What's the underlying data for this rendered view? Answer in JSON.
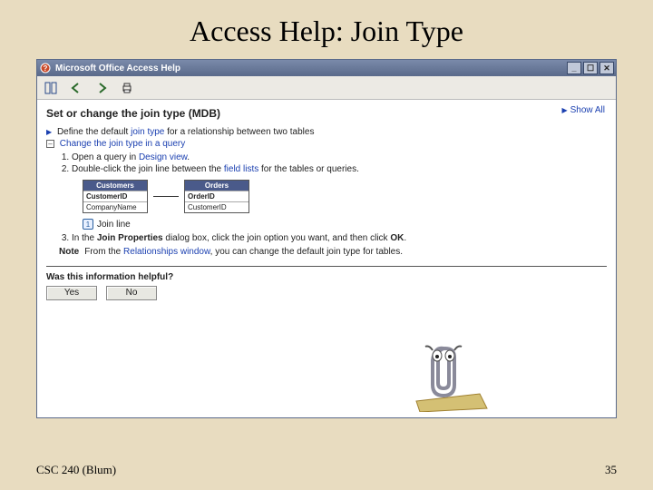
{
  "slide": {
    "title": "Access Help: Join Type",
    "footer_left": "CSC 240 (Blum)",
    "footer_right": "35"
  },
  "window": {
    "title": "Microsoft Office Access Help",
    "toolbar": {
      "tile": "tile-icon",
      "back": "back-icon",
      "forward": "forward-icon",
      "print": "print-icon"
    }
  },
  "help": {
    "topic_title": "Set or change the join type (MDB)",
    "show_all": "Show All",
    "line1_prefix": "Define the default ",
    "line1_link": "join type",
    "line1_suffix": " for a relationship between two tables",
    "line2": "Change the join type in a query",
    "steps": [
      {
        "text_a": "Open a query in ",
        "link": "Design view",
        "text_b": "."
      },
      {
        "text_a": "Double-click the join line between the ",
        "link": "field lists",
        "text_b": " for the tables or queries."
      }
    ],
    "diagram": {
      "table_left": {
        "name": "Customers",
        "rows": [
          "CustomerID",
          "CompanyName"
        ]
      },
      "table_right": {
        "name": "Orders",
        "rows": [
          "OrderID",
          "CustomerID"
        ]
      }
    },
    "callout": {
      "num": "1",
      "label": "Join line"
    },
    "step3_a": "In the ",
    "step3_bold": "Join Properties",
    "step3_b": " dialog box, click the join option you want, and then click ",
    "step3_bold2": "OK",
    "step3_c": ".",
    "note_label": "Note",
    "note_a": "From the ",
    "note_link": "Relationships window",
    "note_b": ", you can change the default join type for tables.",
    "feedback_q": "Was this information helpful?",
    "yes": "Yes",
    "no": "No"
  }
}
